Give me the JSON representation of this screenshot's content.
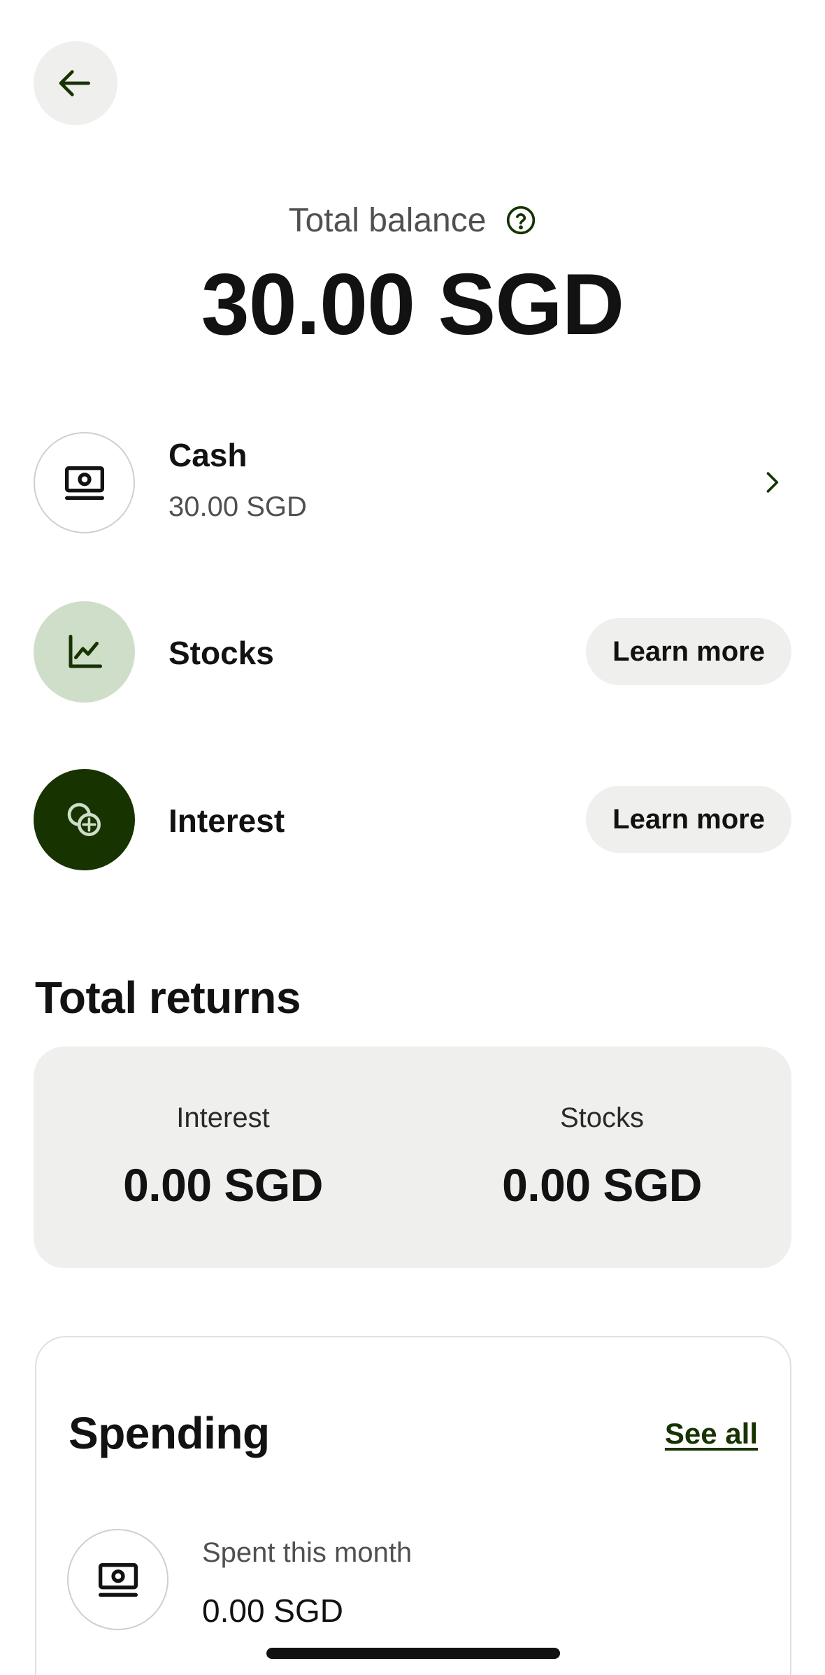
{
  "header": {
    "back_icon": "arrow-left-icon"
  },
  "balance": {
    "label": "Total balance",
    "help_icon": "question-circle-icon",
    "amount": "30.00 SGD"
  },
  "accounts": [
    {
      "title": "Cash",
      "subtitle": "30.00 SGD",
      "icon": "banknote-icon",
      "action": "chevron-right-icon"
    },
    {
      "title": "Stocks",
      "icon": "line-chart-icon",
      "action_label": "Learn more"
    },
    {
      "title": "Interest",
      "icon": "coins-sparkle-icon",
      "action_label": "Learn more"
    }
  ],
  "returns": {
    "title": "Total returns",
    "interest_label": "Interest",
    "interest_value": "0.00 SGD",
    "stocks_label": "Stocks",
    "stocks_value": "0.00 SGD"
  },
  "spending": {
    "title": "Spending",
    "see_all_label": "See all",
    "spent_label": "Spent this month",
    "spent_value": "0.00 SGD",
    "icon": "banknote-icon"
  },
  "colors": {
    "accent_dark": "#163300",
    "accent_light": "#cfdec8",
    "surface": "#efefed",
    "text": "#121212",
    "muted": "#505050"
  }
}
